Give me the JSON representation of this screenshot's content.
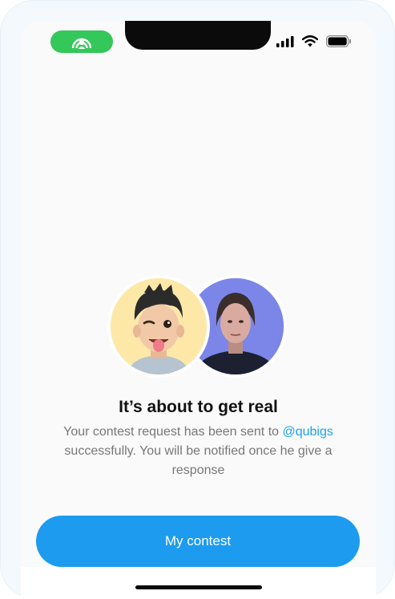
{
  "status_bar": {
    "accent_color": "#34c759",
    "indicator_icon": "person-broadcast-icon",
    "signal_icon": "cellular-signal-icon",
    "wifi_icon": "wifi-icon",
    "battery_icon": "battery-icon"
  },
  "avatars": [
    {
      "name": "memoji-avatar",
      "bg": "#fde8a8"
    },
    {
      "name": "portrait-avatar",
      "bg": "#7b86e8"
    }
  ],
  "content": {
    "title": "It’s about to get real",
    "message_prefix": "Your contest request has been sent to ",
    "mention": "@qubigs",
    "message_suffix": " successfully. You will be notified once he give a response"
  },
  "button": {
    "label": "My contest",
    "color": "#1c9bef"
  }
}
